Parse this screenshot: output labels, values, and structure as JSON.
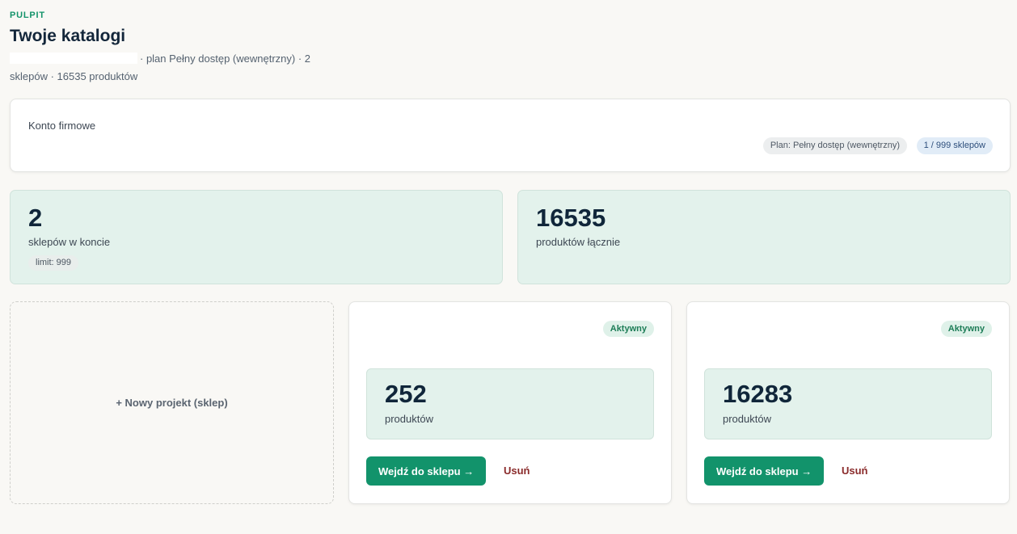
{
  "header": {
    "eyebrow": "PULPIT",
    "title": "Twoje katalogi",
    "subtitle": "· plan Pełny dostęp (wewnętrzny) · 2 sklepów · 16535 produktów"
  },
  "account": {
    "title": "Konto firmowe",
    "plan_badge": "Plan: Pełny dostęp (wewnętrzny)",
    "limit_badge": "1 / 999 sklepów"
  },
  "stats": [
    {
      "value": "2",
      "label": "sklepów w koncie",
      "chip": "limit: 999"
    },
    {
      "value": "16535",
      "label": "produktów łącznie"
    }
  ],
  "new_project_label": "+ Nowy projekt (sklep)",
  "shops": [
    {
      "status": "Aktywny",
      "products": "252",
      "products_label": "produktów",
      "enter_label": "Wejdź do sklepu →",
      "delete_label": "Usuń"
    },
    {
      "status": "Aktywny",
      "products": "16283",
      "products_label": "produktów",
      "enter_label": "Wejdź do sklepu →",
      "delete_label": "Usuń"
    }
  ]
}
